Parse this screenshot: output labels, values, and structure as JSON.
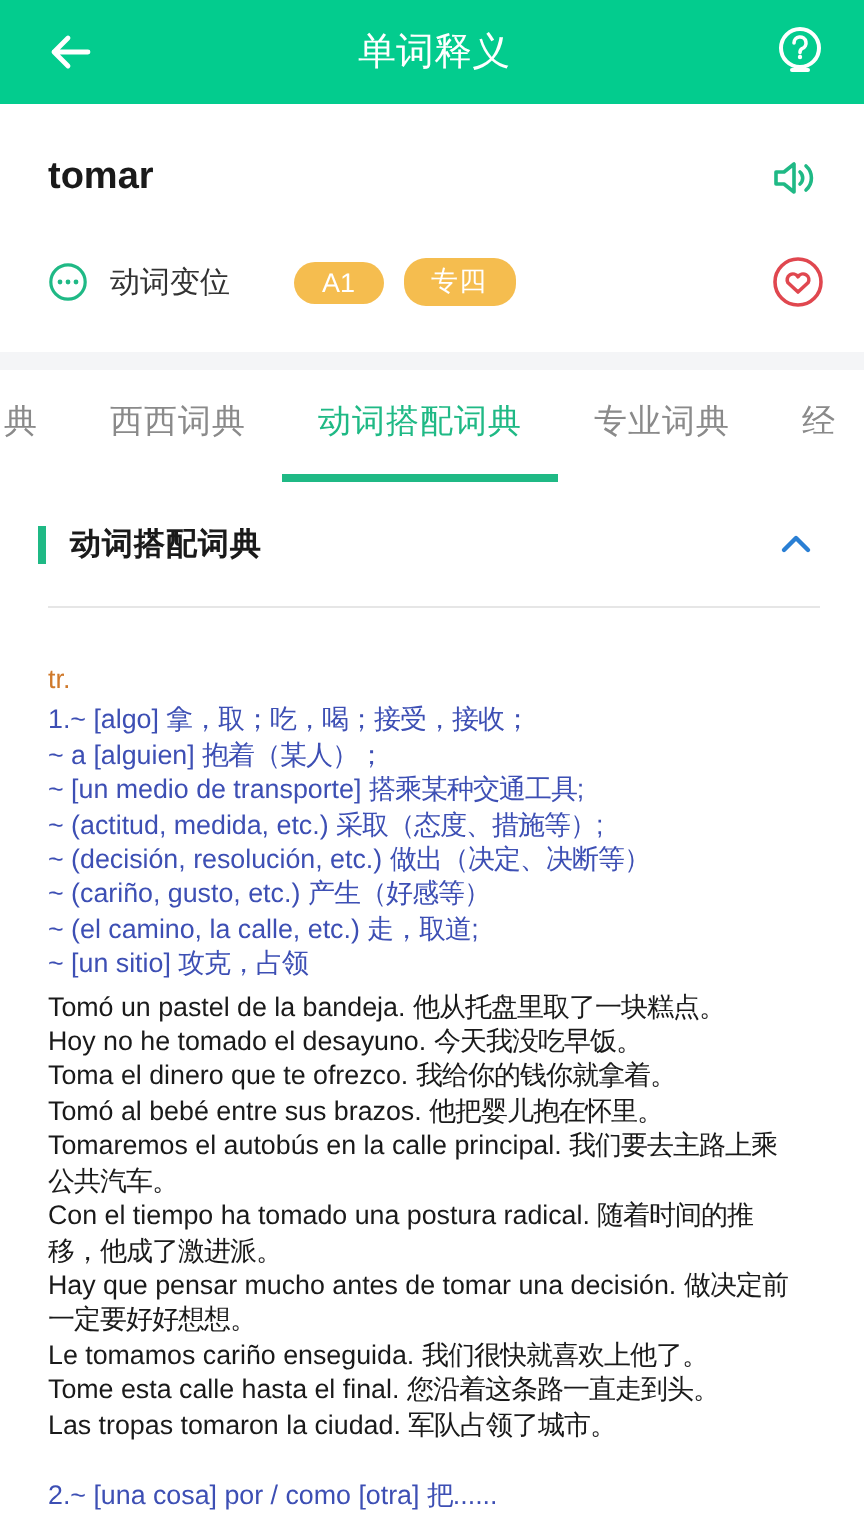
{
  "header": {
    "title": "单词释义"
  },
  "word": {
    "headword": "tomar",
    "conjugation_label": "动词变位",
    "tags": [
      "A1",
      "专四"
    ]
  },
  "tabs": [
    {
      "label": "典",
      "selected": false
    },
    {
      "label": "西西词典",
      "selected": false
    },
    {
      "label": "动词搭配词典",
      "selected": true
    },
    {
      "label": "专业词典",
      "selected": false
    },
    {
      "label": "经",
      "selected": false
    }
  ],
  "section": {
    "title": "动词搭配词典",
    "expanded": true
  },
  "entry": {
    "pos": "tr.",
    "senses": [
      {
        "lines": [
          "1.~ [algo] 拿，取；吃，喝；接受，接收；",
          "~ a [alguien] 抱着（某人）；",
          "~ [un medio de transporte] 搭乘某种交通工具;",
          "~ (actitud, medida, etc.) 采取（态度、措施等）;",
          "~ (decisión, resolución, etc.) 做出（决定、决断等）",
          "~ (cariño, gusto, etc.) 产生（好感等）",
          "~ (el camino, la calle, etc.) 走，取道;",
          "~ [un sitio] 攻克，占领"
        ],
        "examples": [
          "Tomó un pastel de la bandeja. 他从托盘里取了一块糕点。",
          "Hoy no he tomado el desayuno. 今天我没吃早饭。",
          "Toma el dinero que te ofrezco. 我给你的钱你就拿着。",
          "Tomó al bebé entre sus brazos. 他把婴儿抱在怀里。",
          "Tomaremos el autobús en la calle principal. 我们要去主路上乘公共汽车。",
          "Con el tiempo ha tomado una postura radical. 随着时间的推移，他成了激进派。",
          "Hay que pensar mucho antes de tomar una decisión. 做决定前一定要好好想想。",
          "Le tomamos cariño enseguida. 我们很快就喜欢上他了。",
          "Tome esta calle hasta el final. 您沿着这条路一直走到头。",
          "Las tropas tomaron la ciudad. 军队占领了城市。"
        ]
      },
      {
        "lines": [
          "2.~ [una cosa] por / como [otra]  把......"
        ]
      }
    ]
  }
}
